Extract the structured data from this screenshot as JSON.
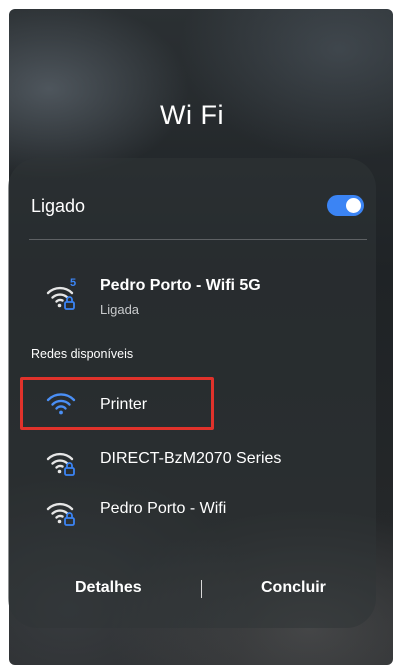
{
  "dialog": {
    "title": "Wi Fi",
    "toggle_label": "Ligado",
    "toggle_on": true,
    "accent_color": "#3b84f4"
  },
  "connected": {
    "name": "Pedro Porto - Wifi 5G",
    "status": "Ligada",
    "band_badge": "5",
    "icon": "wifi-locked-icon"
  },
  "available": {
    "header": "Redes disponíveis",
    "networks": [
      {
        "name": "Printer",
        "icon": "wifi-icon",
        "secured": false,
        "highlighted": true
      },
      {
        "name": "DIRECT-BzM2070 Series",
        "icon": "wifi-locked-icon",
        "secured": true,
        "highlighted": false
      },
      {
        "name": "Pedro Porto - Wifi",
        "icon": "wifi-locked-icon",
        "secured": true,
        "highlighted": false
      }
    ]
  },
  "footer": {
    "details_label": "Detalhes",
    "done_label": "Concluir"
  },
  "annotation": {
    "color": "#e0322b"
  }
}
